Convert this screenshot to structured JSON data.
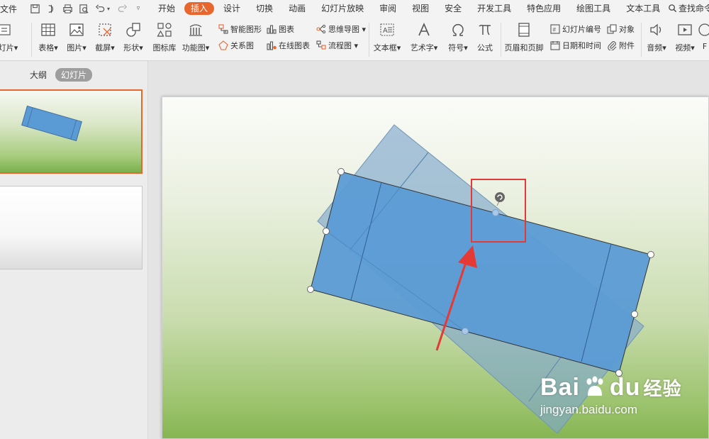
{
  "menubar": {
    "file_label": "文件",
    "tabs": [
      {
        "label": "开始"
      },
      {
        "label": "插入"
      },
      {
        "label": "设计"
      },
      {
        "label": "切换"
      },
      {
        "label": "动画"
      },
      {
        "label": "幻灯片放映"
      },
      {
        "label": "审阅"
      },
      {
        "label": "视图"
      },
      {
        "label": "安全"
      },
      {
        "label": "开发工具"
      },
      {
        "label": "特色应用"
      },
      {
        "label": "绘图工具"
      },
      {
        "label": "文本工具"
      }
    ],
    "active_tab": "插入",
    "search_label": "查找命令"
  },
  "ribbon": {
    "new_slide": "幻灯片",
    "table": "表格",
    "picture": "图片",
    "screenshot": "截屏",
    "shape": "形状",
    "icon_library": "图标库",
    "function_chart": "功能图",
    "smart_art": "智能图形",
    "chart": "图表",
    "relation_chart": "关系图",
    "online_chart": "在线图表",
    "mind_map": "思维导图",
    "flowchart": "流程图",
    "textbox": "文本框",
    "wordart": "艺术字",
    "symbol": "符号",
    "formula": "公式",
    "header_footer": "页眉和页脚",
    "slide_number": "幻灯片编号",
    "date_time": "日期和时间",
    "object": "对象",
    "attachment": "附件",
    "audio": "音频",
    "video": "视频",
    "flash": "F"
  },
  "leftpane": {
    "outline_tab": "大纲",
    "slides_tab": "幻灯片"
  },
  "watermark": {
    "logo": "Bai",
    "logo_suffix": "du",
    "logo_cn": "经验",
    "url": "jingyan.baidu.com"
  },
  "colors": {
    "accent": "#e8672f",
    "shape_fill": "#5b9bd5",
    "ghost_fill": "#7fa8cc",
    "highlight": "#e53935"
  }
}
